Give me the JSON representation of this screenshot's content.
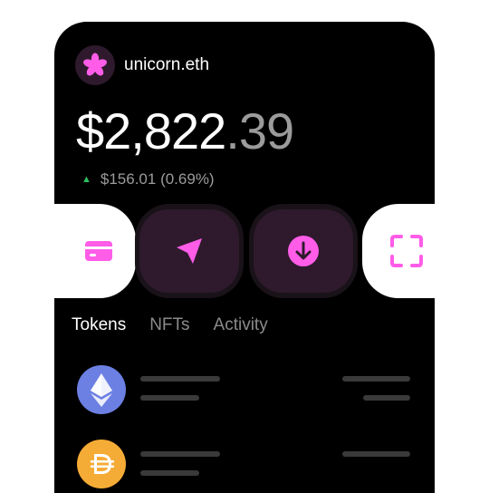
{
  "wallet": {
    "ens_name": "unicorn.eth",
    "avatar_icon": "flower-icon",
    "accent_color": "#ff5ce8"
  },
  "balance": {
    "integer_part": "$2,822",
    "decimal_part": ".39"
  },
  "change": {
    "direction_icon": "triangle-up-icon",
    "direction_color": "#2fbf62",
    "text": "$156.01 (0.69%)"
  },
  "actions": [
    {
      "name": "buy",
      "icon": "credit-card-icon"
    },
    {
      "name": "send",
      "icon": "send-arrow-icon"
    },
    {
      "name": "receive",
      "icon": "arrow-down-circle-icon"
    },
    {
      "name": "scan",
      "icon": "scan-frame-icon"
    }
  ],
  "tabs": [
    {
      "label": "Tokens",
      "active": true
    },
    {
      "label": "NFTs",
      "active": false
    },
    {
      "label": "Activity",
      "active": false
    }
  ],
  "tokens": [
    {
      "icon": "ethereum-icon",
      "color": "#6c80e3"
    },
    {
      "icon": "dai-icon",
      "color": "#f5ac37"
    }
  ]
}
